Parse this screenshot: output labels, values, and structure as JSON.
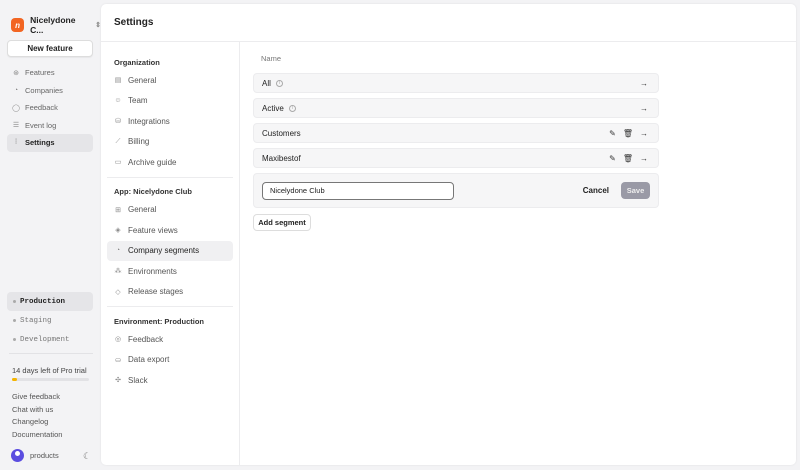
{
  "org": {
    "name": "Nicelydone C...",
    "logo": "n"
  },
  "new_feature": "New feature",
  "nav": [
    {
      "label": "Features",
      "icon": "features-icon",
      "g": "⊛"
    },
    {
      "label": "Companies",
      "icon": "pie-icon",
      "g": "◔"
    },
    {
      "label": "Feedback",
      "icon": "chat-icon",
      "g": "◯"
    },
    {
      "label": "Event log",
      "icon": "log-icon",
      "g": "☰"
    },
    {
      "label": "Settings",
      "icon": "sliders-icon",
      "g": "⫶",
      "active": true
    }
  ],
  "envs": [
    {
      "label": "Production",
      "active": true
    },
    {
      "label": "Staging"
    },
    {
      "label": "Development"
    }
  ],
  "trial": {
    "text": "14 days left of Pro trial",
    "progress": 0.07,
    "color": "#f5b400"
  },
  "links": [
    "Give feedback",
    "Chat with us",
    "Changelog",
    "Documentation"
  ],
  "user": "products",
  "page_title": "Settings",
  "sections": [
    {
      "title": "Organization",
      "items": [
        {
          "label": "General",
          "g": "▤"
        },
        {
          "label": "Team",
          "g": "☺"
        },
        {
          "label": "Integrations",
          "g": "⛁"
        },
        {
          "label": "Billing",
          "g": "⟋"
        },
        {
          "label": "Archive guide",
          "g": "▭"
        }
      ]
    },
    {
      "title": "App: Nicelydone Club",
      "items": [
        {
          "label": "General",
          "g": "⊞"
        },
        {
          "label": "Feature views",
          "g": "◈"
        },
        {
          "label": "Company segments",
          "g": "◔",
          "active": true
        },
        {
          "label": "Environments",
          "g": "⁂"
        },
        {
          "label": "Release stages",
          "g": "◇"
        }
      ]
    },
    {
      "title": "Environment: Production",
      "items": [
        {
          "label": "Feedback",
          "g": "◎"
        },
        {
          "label": "Data export",
          "g": "⛀"
        },
        {
          "label": "Slack",
          "g": "✣"
        }
      ]
    }
  ],
  "segments": {
    "column": "Name",
    "rows": [
      {
        "name": "All",
        "info": true
      },
      {
        "name": "Active",
        "info": true
      },
      {
        "name": "Customers",
        "editable": true
      },
      {
        "name": "Maxibestof",
        "editable": true
      }
    ],
    "input_value": "Nicelydone Club",
    "cancel": "Cancel",
    "save": "Save",
    "add": "Add segment"
  }
}
